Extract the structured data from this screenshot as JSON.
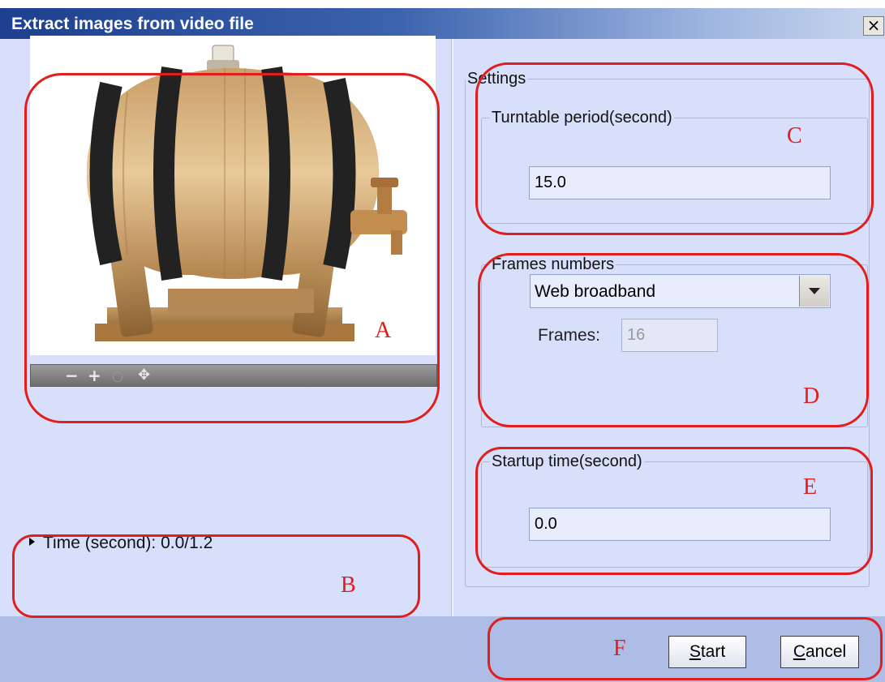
{
  "window": {
    "title": "Extract images from video file",
    "close_symbol": "×"
  },
  "settings": {
    "group_label": "Settings",
    "turntable": {
      "label": "Turntable period(second)",
      "value": "15.0"
    },
    "frames": {
      "label": "Frames numbers",
      "selected": "Web broadband",
      "frames_label": "Frames:",
      "frames_value": "16"
    },
    "startup": {
      "label": "Startup time(second)",
      "value": "0.0"
    }
  },
  "preview": {
    "zoom_icons": [
      "minus-icon",
      "plus-icon",
      "reset-zoom-icon",
      "pan-icon"
    ]
  },
  "time": {
    "label": "Time (second): 0.0/1.2"
  },
  "buttons": {
    "start": {
      "mnemonic": "S",
      "rest": "tart"
    },
    "cancel": {
      "mnemonic": "C",
      "rest": "ancel"
    }
  },
  "annotations": {
    "a": "A",
    "b": "B",
    "c": "C",
    "d": "D",
    "e": "E",
    "f": "F"
  },
  "colors": {
    "annotation_red": "#e11d1d",
    "title_blue": "#1d3f8e",
    "panel_bg": "#d8dffa"
  }
}
